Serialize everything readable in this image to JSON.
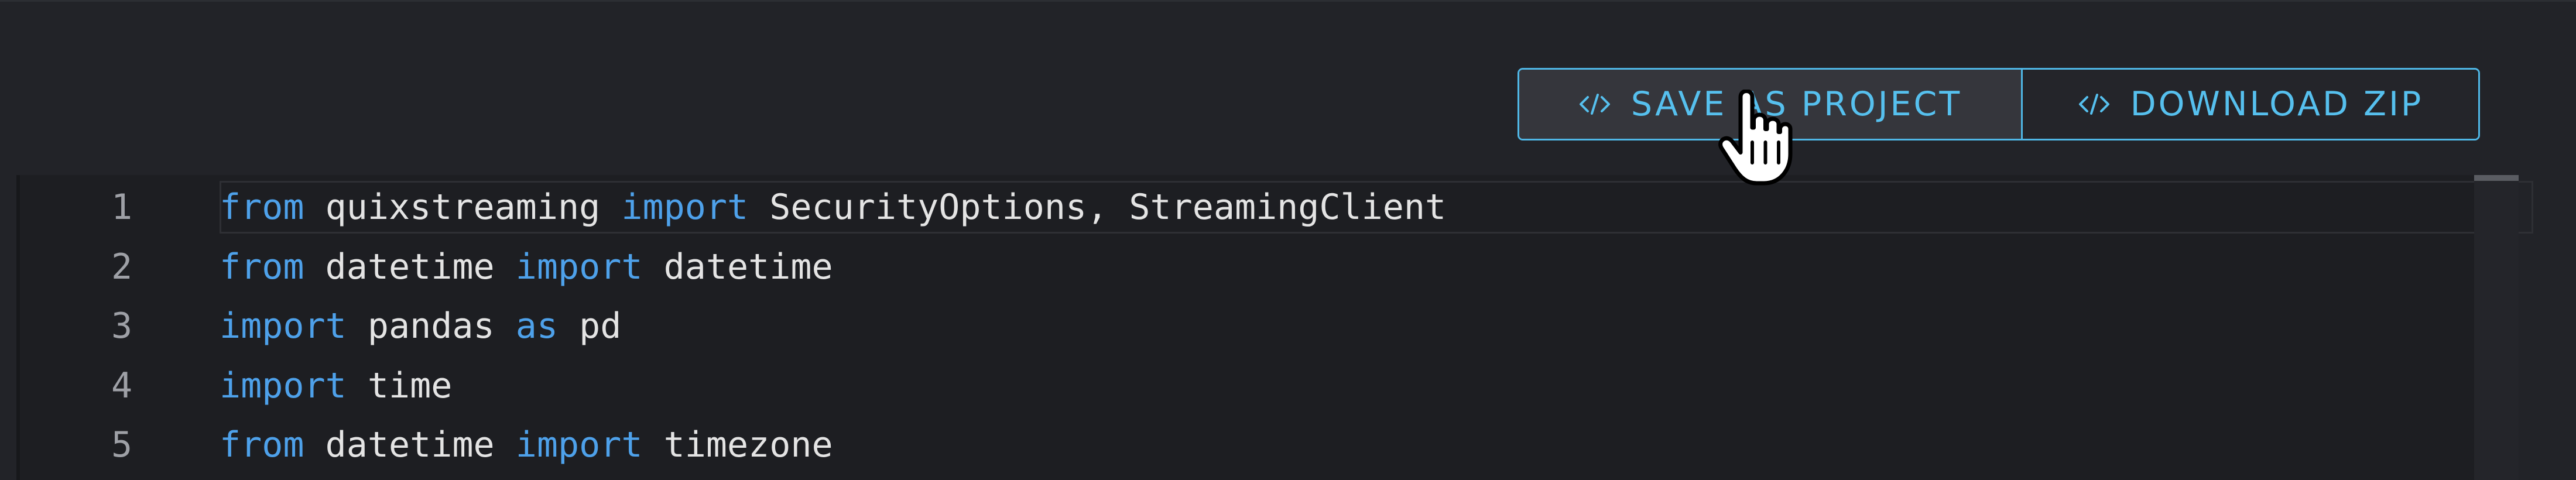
{
  "toolbar": {
    "save_label": "SAVE AS PROJECT",
    "download_label": "DOWNLOAD ZIP",
    "icon": "code-icon",
    "accent_color": "#4fb7e6"
  },
  "editor": {
    "keyword_color": "#4ea1ea",
    "lines": [
      {
        "number": "1",
        "tokens": [
          {
            "t": "from",
            "kw": true
          },
          {
            "t": " quixstreaming ",
            "kw": false
          },
          {
            "t": "import",
            "kw": true
          },
          {
            "t": " SecurityOptions, StreamingClient",
            "kw": false
          }
        ]
      },
      {
        "number": "2",
        "tokens": [
          {
            "t": "from",
            "kw": true
          },
          {
            "t": " datetime ",
            "kw": false
          },
          {
            "t": "import",
            "kw": true
          },
          {
            "t": " datetime",
            "kw": false
          }
        ]
      },
      {
        "number": "3",
        "tokens": [
          {
            "t": "import",
            "kw": true
          },
          {
            "t": " pandas ",
            "kw": false
          },
          {
            "t": "as",
            "kw": true
          },
          {
            "t": " pd",
            "kw": false
          }
        ]
      },
      {
        "number": "4",
        "tokens": [
          {
            "t": "import",
            "kw": true
          },
          {
            "t": " time",
            "kw": false
          }
        ]
      },
      {
        "number": "5",
        "tokens": [
          {
            "t": "from",
            "kw": true
          },
          {
            "t": " datetime ",
            "kw": false
          },
          {
            "t": "import",
            "kw": true
          },
          {
            "t": " timezone",
            "kw": false
          }
        ]
      }
    ]
  },
  "cursor": {
    "icon": "hand-pointer-icon"
  }
}
